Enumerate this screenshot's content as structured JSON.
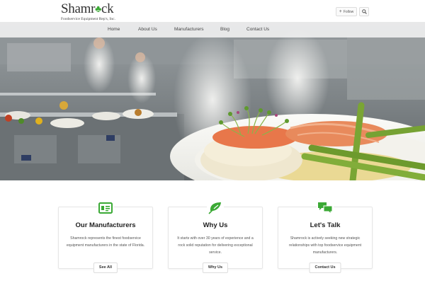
{
  "brand": {
    "name_prefix": "Shamr",
    "name_suffix": "ck",
    "tagline": "Foodservice Equipment Rep's, Inc.",
    "accent": "#3ba935"
  },
  "header": {
    "follow_label": "Follow",
    "follow_icon": "plus-icon",
    "search_icon": "search-icon"
  },
  "nav": {
    "items": [
      {
        "label": "Home"
      },
      {
        "label": "About Us"
      },
      {
        "label": "Manufacturers"
      },
      {
        "label": "Blog"
      },
      {
        "label": "Contact Us"
      }
    ]
  },
  "hero": {
    "image": "restaurant kitchen with chefs and plated salmon, asparagus and mashed potatoes"
  },
  "features": [
    {
      "icon": "list-card-icon",
      "title": "Our Manufacturers",
      "text": "Shamrock represents the finest foodservice equipment manufacturers in the state of Florida.",
      "button": "See All"
    },
    {
      "icon": "leaf-icon",
      "title": "Why Us",
      "text": "It starts with over 30 years of experience and a rock solid reputation for delivering exceptional service.",
      "button": "Why Us"
    },
    {
      "icon": "chat-bubbles-icon",
      "title": "Let's Talk",
      "text": "Shamrock is actively seeking new strategic relationships with top foodservice equipment manufacturers.",
      "button": "Contact Us"
    }
  ]
}
